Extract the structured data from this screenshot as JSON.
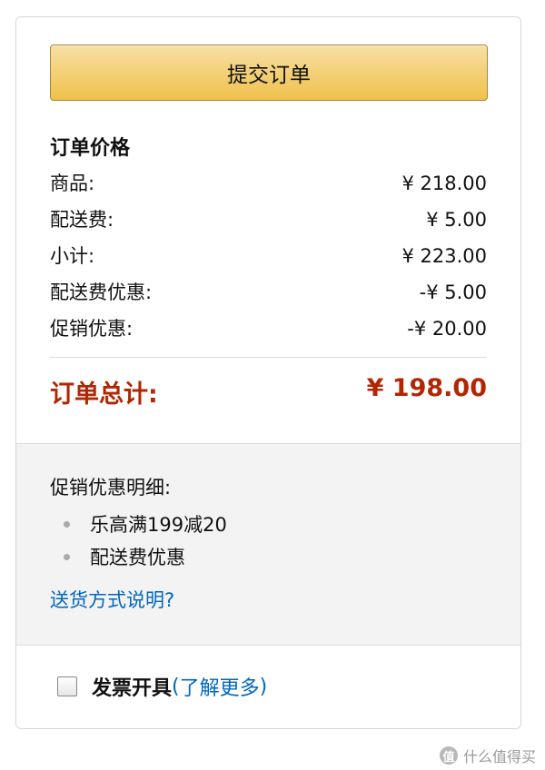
{
  "submit": {
    "label": "提交订单"
  },
  "summary": {
    "title": "订单价格",
    "rows": [
      {
        "label": "商品:",
        "amount": "¥ 218.00"
      },
      {
        "label": "配送费:",
        "amount": "¥ 5.00"
      },
      {
        "label": "小计:",
        "amount": "¥ 223.00"
      },
      {
        "label": "配送费优惠:",
        "amount": "-¥ 5.00"
      },
      {
        "label": "促销优惠:",
        "amount": "-¥ 20.00"
      }
    ],
    "total_label": "订单总计:",
    "total_amount": "¥ 198.00"
  },
  "promotions": {
    "title": "促销优惠明细:",
    "items": [
      "乐高满199减20",
      "配送费优惠"
    ],
    "help_link": "送货方式说明?"
  },
  "invoice": {
    "label": "发票开具",
    "link_open": "(",
    "link": "了解更多",
    "link_close": ")"
  },
  "watermark": {
    "logo_glyph": "值",
    "text": "什么值得买"
  },
  "colors": {
    "total_red": "#b12704",
    "link_blue": "#0066c0",
    "button_gold": "#f0c14b"
  }
}
